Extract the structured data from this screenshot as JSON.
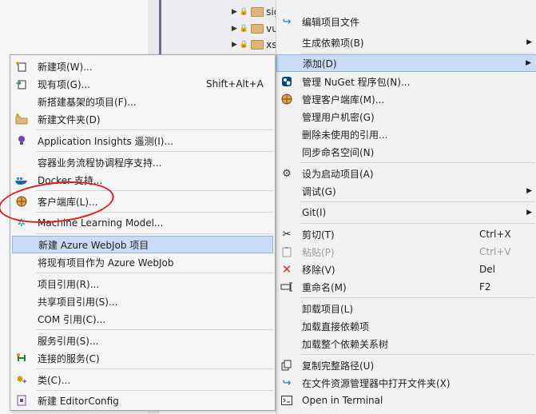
{
  "tree": {
    "rows": [
      {
        "name": "sig"
      },
      {
        "name": "vu"
      },
      {
        "name": "xs"
      }
    ]
  },
  "context_menu": {
    "items": [
      {
        "label": "编辑项目文件",
        "icon": "refresh-arrow-icon"
      },
      {
        "label": "生成依赖项(B)",
        "has_submenu": true
      },
      {
        "label": "添加(D)",
        "has_submenu": true,
        "selected": true
      },
      {
        "label": "管理 NuGet 程序包(N)...",
        "icon": "nuget-icon"
      },
      {
        "label": "管理客户端库(M)...",
        "icon": "globe-icon"
      },
      {
        "label": "管理用户机密(G)"
      },
      {
        "label": "删除未使用的引用..."
      },
      {
        "label": "同步命名空间(N)"
      },
      {
        "label": "设为启动项目(A)",
        "icon": "gear-icon"
      },
      {
        "label": "调试(G)",
        "has_submenu": true
      },
      {
        "label": "Git(I)",
        "has_submenu": true
      },
      {
        "label": "剪切(T)",
        "shortcut": "Ctrl+X",
        "icon": "scissors-icon"
      },
      {
        "label": "粘贴(P)",
        "shortcut": "Ctrl+V",
        "icon": "paste-icon",
        "disabled": true
      },
      {
        "label": "移除(V)",
        "shortcut": "Del",
        "icon": "remove-x-icon"
      },
      {
        "label": "重命名(M)",
        "shortcut": "F2",
        "icon": "rename-icon"
      },
      {
        "label": "卸载项目(L)"
      },
      {
        "label": "加载直接依赖项"
      },
      {
        "label": "加载整个依赖关系树"
      },
      {
        "label": "复制完整路径(U)",
        "icon": "copy-icon"
      },
      {
        "label": "在文件资源管理器中打开文件夹(X)",
        "icon": "refresh-arrow-icon"
      },
      {
        "label": "Open in Terminal",
        "icon": "terminal-icon"
      }
    ]
  },
  "add_submenu": {
    "items": [
      {
        "label": "新建项(W)...",
        "icon": "new-item-icon"
      },
      {
        "label": "现有项(G)...",
        "shortcut": "Shift+Alt+A",
        "icon": "existing-item-icon"
      },
      {
        "label": "新搭建基架的项目(F)..."
      },
      {
        "label": "新建文件夹(D)",
        "icon": "new-folder-icon"
      },
      {
        "label": "Application Insights 遥测(I)...",
        "icon": "lightbulb-icon"
      },
      {
        "label": "容器业务流程协调程序支持..."
      },
      {
        "label": "Docker 支持...",
        "icon": "docker-icon"
      },
      {
        "label": "客户端库(L)...",
        "icon": "globe-icon"
      },
      {
        "label": "Machine Learning Model...",
        "icon": "ml-model-icon"
      },
      {
        "label": "新建 Azure WebJob 项目",
        "selected": true
      },
      {
        "label": "将现有项目作为 Azure WebJob"
      },
      {
        "label": "项目引用(R)..."
      },
      {
        "label": "共享项目引用(S)..."
      },
      {
        "label": "COM 引用(C)..."
      },
      {
        "label": "服务引用(S)..."
      },
      {
        "label": "连接的服务(C)",
        "icon": "connected-service-icon"
      },
      {
        "label": "类(C)...",
        "icon": "class-icon"
      },
      {
        "label": "新建 EditorConfig",
        "icon": "editorconfig-icon"
      }
    ]
  },
  "colors": {
    "selection_bg": "#c9dcf5",
    "annotation_red": "#e01e1e"
  }
}
